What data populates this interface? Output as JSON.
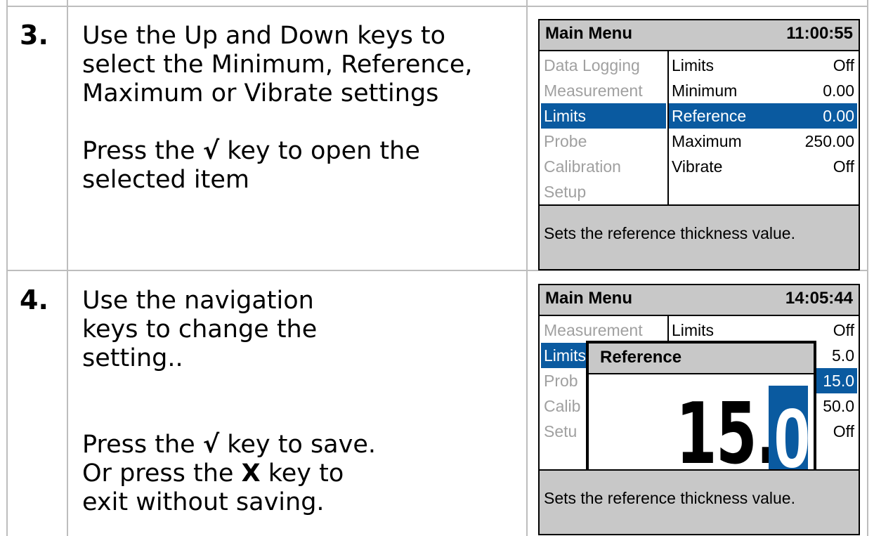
{
  "steps": [
    {
      "number": "3.",
      "text1": "Use the Up and Down keys to select the Minimum, Reference, Maximum or Vibrate settings",
      "text2_pre": "Press the ",
      "text2_check": "√",
      "text2_post": " key to open the selected item"
    },
    {
      "number": "4.",
      "text1": "Use the navigation keys to change the setting..",
      "text2_pre": "Press the ",
      "text2_check": "√",
      "text2_post": " key to save.",
      "text3_pre": "Or press the ",
      "text3_x": "X",
      "text3_post": " key to exit without saving."
    }
  ],
  "screen1": {
    "title": "Main Menu",
    "time": "11:00:55",
    "left_menu": [
      "Data Logging",
      "Measurement",
      "Limits",
      "Probe",
      "Calibration",
      "Setup"
    ],
    "left_selected_index": 2,
    "right_items": [
      {
        "label": "Limits",
        "value": "Off"
      },
      {
        "label": "Minimum",
        "value": "0.00"
      },
      {
        "label": "Reference",
        "value": "0.00"
      },
      {
        "label": "Maximum",
        "value": "250.00"
      },
      {
        "label": "Vibrate",
        "value": "Off"
      }
    ],
    "right_selected_index": 2,
    "footer": "Sets the reference thickness value."
  },
  "screen2": {
    "title": "Main Menu",
    "time": "14:05:44",
    "left_menu": [
      "Measurement",
      "Limits",
      "Probe",
      "Calibration",
      "Setup"
    ],
    "left_menu_partial": [
      "Measurement",
      "Limits",
      "Prob",
      "Calib",
      "Setu"
    ],
    "left_selected_index": 1,
    "right_items": [
      {
        "label": "Limits",
        "value": "Off"
      },
      {
        "label": "",
        "value": "5.0"
      },
      {
        "label": "",
        "value": "15.0"
      },
      {
        "label": "",
        "value": "50.0"
      },
      {
        "label": "",
        "value": "Off"
      }
    ],
    "right_selected_index": 2,
    "popup": {
      "title": "Reference",
      "value_main": "15.",
      "value_cursor": "0"
    },
    "footer": "Sets the reference thickness value."
  },
  "colors": {
    "highlight": "#0a5aa0",
    "header_gray": "#c8c8c8",
    "grid": "#bdbdbd",
    "disabled_text": "#a0a0a0"
  }
}
